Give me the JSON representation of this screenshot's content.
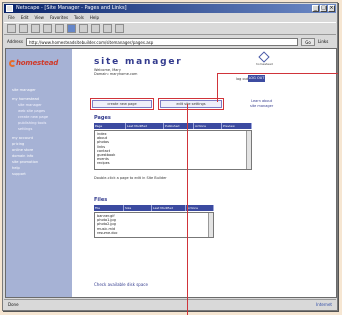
{
  "window": {
    "title": "Netscape - [Site Manager - Pages and Links]",
    "minimize": "_",
    "maximize": "□",
    "close": "×"
  },
  "menu": [
    "File",
    "Edit",
    "View",
    "Favorites",
    "Tools",
    "Help"
  ],
  "address": {
    "label": "Address",
    "value": "http://www.homesteadsitebuilder.com/sitemanager/pages.asp",
    "go_label": "Go",
    "links_label": "Links"
  },
  "sidebar": {
    "logo_text": "homestead",
    "items": [
      {
        "label": "site manager",
        "sub": false
      },
      {
        "label": "my homestead",
        "sub": false
      },
      {
        "label": "site manager",
        "sub": true
      },
      {
        "label": "web site pages",
        "sub": true
      },
      {
        "label": "create new page",
        "sub": true
      },
      {
        "label": "publishing tools",
        "sub": true
      },
      {
        "label": "settings",
        "sub": true
      },
      {
        "label": "my account",
        "sub": false
      },
      {
        "label": "pricing",
        "sub": false
      },
      {
        "label": "online store",
        "sub": false
      },
      {
        "label": "domain info",
        "sub": false
      },
      {
        "label": "site promotion",
        "sub": false
      },
      {
        "label": "help",
        "sub": false
      },
      {
        "label": "support",
        "sub": false
      }
    ]
  },
  "main": {
    "title": "site manager",
    "meta_lines": [
      "Welcome, Mary",
      "Domain: maryhome.com"
    ],
    "cube_label": "homestead",
    "logout_label": "log out",
    "logout_button": "LOG OUT",
    "buttons": {
      "create_new_page": "create new page",
      "edit_site_settings": "edit site settings"
    },
    "right_links": [
      "Learn about",
      "site manager"
    ],
    "pages_section": {
      "heading": "Pages",
      "columns": [
        "Page",
        "Last Modified",
        "Published",
        "Actions",
        "Preview"
      ],
      "rows": [
        "index",
        "about",
        "photos",
        "links",
        "contact",
        "guestbook",
        "events",
        "recipes"
      ]
    },
    "pages_note": "Double-click a page to edit in Site Builder",
    "files_section": {
      "heading": "Files",
      "columns": [
        "File",
        "Size",
        "Last Modified",
        "Actions"
      ],
      "rows": [
        "banner.gif",
        "photo1.jpg",
        "photo2.jpg",
        "music.mid",
        "resume.doc"
      ]
    },
    "footer_link": "Check available disk space"
  },
  "status": {
    "left": "Done",
    "zone": "Internet"
  },
  "colors": {
    "sidebar_bg": "#a6b2d5",
    "accent_blue": "#3b4aa0",
    "callout_red": "#d0343a",
    "logo_orange": "#e76c2a"
  }
}
